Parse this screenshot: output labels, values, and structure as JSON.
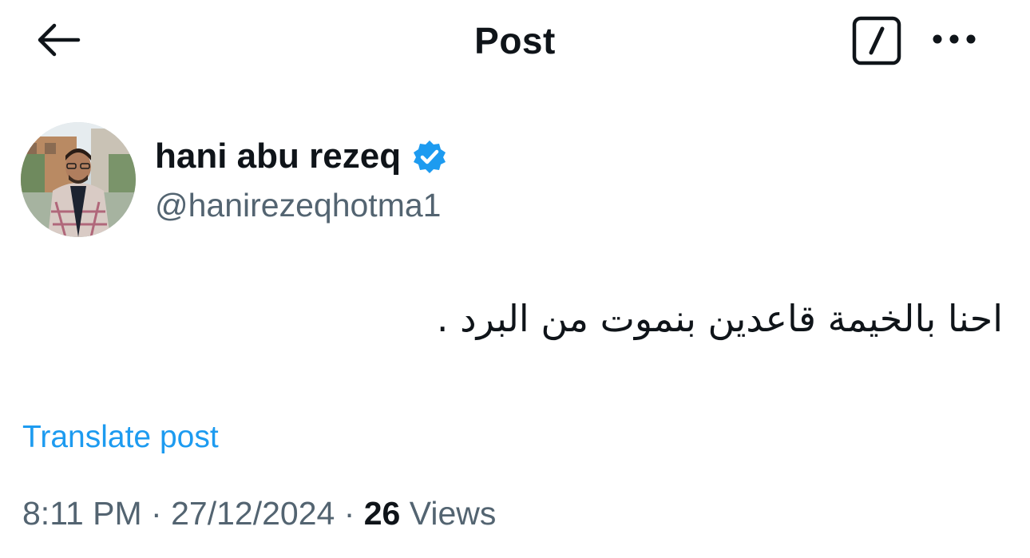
{
  "header": {
    "title": "Post",
    "back_icon": "arrow-left-icon",
    "grok_icon": "grok-slash-icon",
    "more_icon": "more-horizontal-icon"
  },
  "author": {
    "display_name": "hani abu rezeq",
    "handle": "@hanirezeqhotma1",
    "verified_icon": "verified-badge-icon",
    "verified_color": "#1d9bf0"
  },
  "post": {
    "text": "احنا بالخيمة قاعدين بنموت من البرد .",
    "translate_label": "Translate post",
    "time": "8:11 PM",
    "separator": " · ",
    "date": "27/12/2024",
    "views_count": "26",
    "views_label": " Views"
  },
  "colors": {
    "text_primary": "#0f1419",
    "text_secondary": "#536471",
    "link": "#1d9bf0"
  }
}
